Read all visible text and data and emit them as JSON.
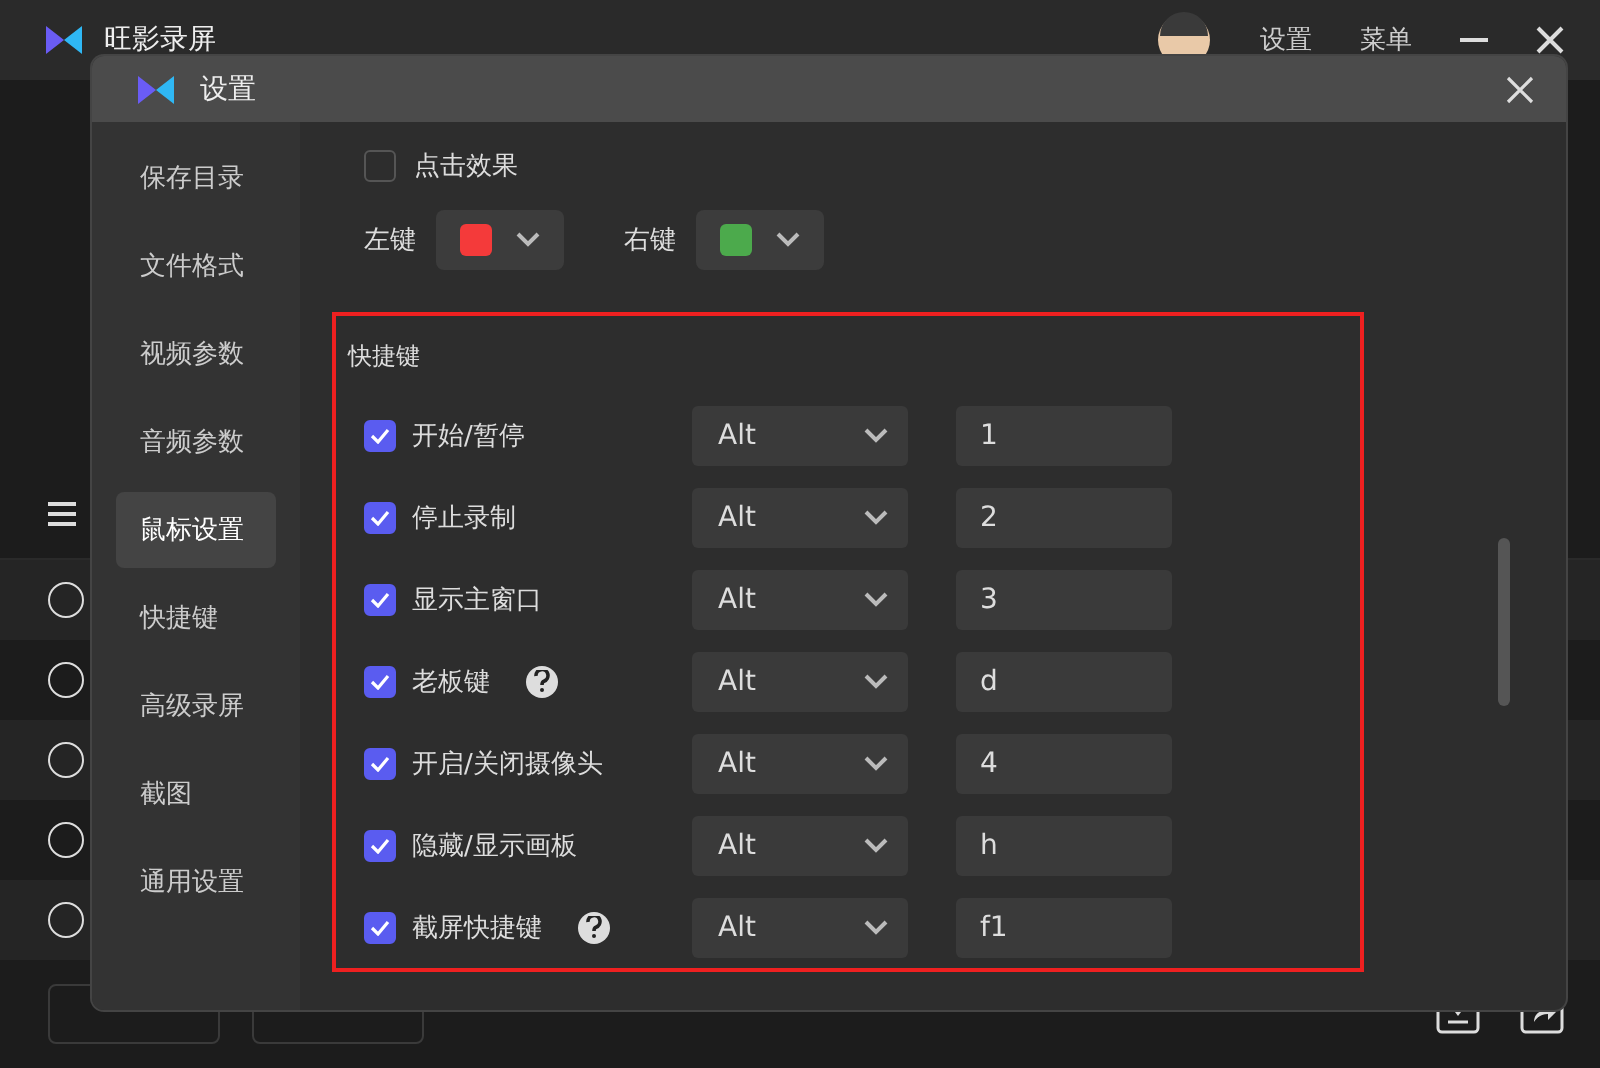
{
  "app": {
    "title": "旺影录屏",
    "menu": [
      "设置",
      "菜单"
    ]
  },
  "background_list": {
    "rows": [
      {
        "selected": false
      },
      {
        "selected": false
      },
      {
        "selected": false
      },
      {
        "selected": false
      },
      {
        "selected": false
      }
    ]
  },
  "dialog": {
    "title": "设置",
    "sidebar": [
      {
        "label": "保存目录",
        "selected": false
      },
      {
        "label": "文件格式",
        "selected": false
      },
      {
        "label": "视频参数",
        "selected": false
      },
      {
        "label": "音频参数",
        "selected": false
      },
      {
        "label": "鼠标设置",
        "selected": true
      },
      {
        "label": "快捷键",
        "selected": false
      },
      {
        "label": "高级录屏",
        "selected": false
      },
      {
        "label": "截图",
        "selected": false
      },
      {
        "label": "通用设置",
        "selected": false
      }
    ],
    "click_effect": {
      "label": "点击效果",
      "checked": false
    },
    "button_colors": [
      {
        "label": "左键",
        "color": "#f43a3a"
      },
      {
        "label": "右键",
        "color": "#4caa4c"
      }
    ],
    "hotkeys": {
      "title": "快捷键",
      "highlighted": true,
      "items": [
        {
          "label": "开始/暂停",
          "checked": true,
          "help": false,
          "modifier": "Alt",
          "key": "1"
        },
        {
          "label": "停止录制",
          "checked": true,
          "help": false,
          "modifier": "Alt",
          "key": "2"
        },
        {
          "label": "显示主窗口",
          "checked": true,
          "help": false,
          "modifier": "Alt",
          "key": "3"
        },
        {
          "label": "老板键",
          "checked": true,
          "help": true,
          "modifier": "Alt",
          "key": "d"
        },
        {
          "label": "开启/关闭摄像头",
          "checked": true,
          "help": false,
          "modifier": "Alt",
          "key": "4"
        },
        {
          "label": "隐藏/显示画板",
          "checked": true,
          "help": false,
          "modifier": "Alt",
          "key": "h"
        },
        {
          "label": "截屏快捷键",
          "checked": true,
          "help": true,
          "modifier": "Alt",
          "key": "f1"
        }
      ]
    }
  }
}
